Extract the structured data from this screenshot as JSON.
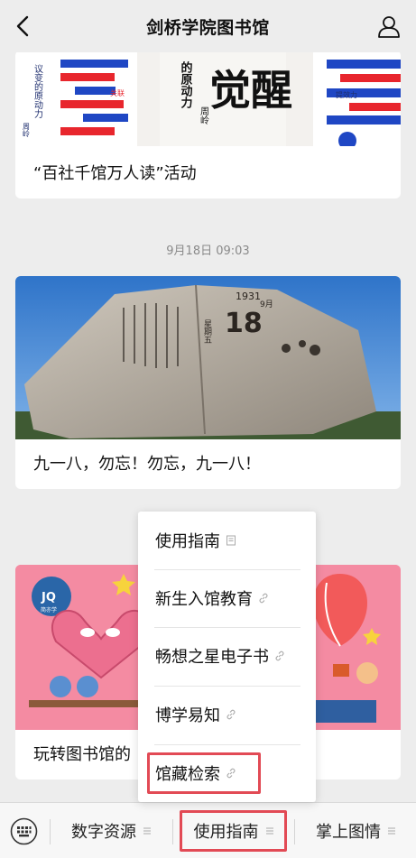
{
  "header": {
    "title": "剑桥学院图书馆"
  },
  "feed": {
    "card1": {
      "art_texts": [
        "议变的原动力",
        "的原动力",
        "觉醒",
        "周岭",
        "关联",
        "反馈",
        "提效力"
      ],
      "caption": "“百社千馆万人读”活动"
    },
    "timestamp": "9月18日 09:03",
    "card2": {
      "art_texts": [
        "1931",
        "18",
        "9月",
        "日",
        "星期五"
      ],
      "caption": "九一八，勿忘！勿忘，九一八！"
    },
    "card3": {
      "art_texts": [
        "JQ",
        "简亦学"
      ],
      "caption": "玩转图书馆的"
    }
  },
  "popup_menu": {
    "items": [
      {
        "label": "使用指南",
        "icon": "article-icon"
      },
      {
        "label": "新生入馆教育",
        "icon": "link-icon"
      },
      {
        "label": "畅想之星电子书",
        "icon": "link-icon"
      },
      {
        "label": "博学易知",
        "icon": "link-icon"
      },
      {
        "label": "馆藏检索",
        "icon": "link-icon"
      }
    ]
  },
  "bottom_menu": {
    "items": [
      {
        "label": "数字资源"
      },
      {
        "label": "使用指南"
      },
      {
        "label": "掌上图情"
      }
    ]
  },
  "colors": {
    "highlight": "#e24a55",
    "background": "#ededed"
  }
}
